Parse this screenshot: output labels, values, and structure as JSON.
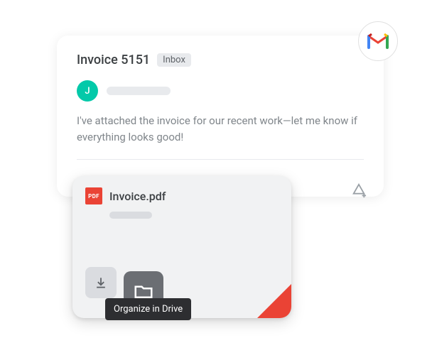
{
  "email": {
    "subject": "Invoice 5151",
    "label": "Inbox",
    "avatar_initial": "J",
    "body": "I've attached the invoice for our recent work—let me know if everything looks good!"
  },
  "attachment": {
    "badge": "PDF",
    "filename": "Invoice.pdf"
  },
  "tooltip": {
    "organize": "Organize in Drive"
  }
}
